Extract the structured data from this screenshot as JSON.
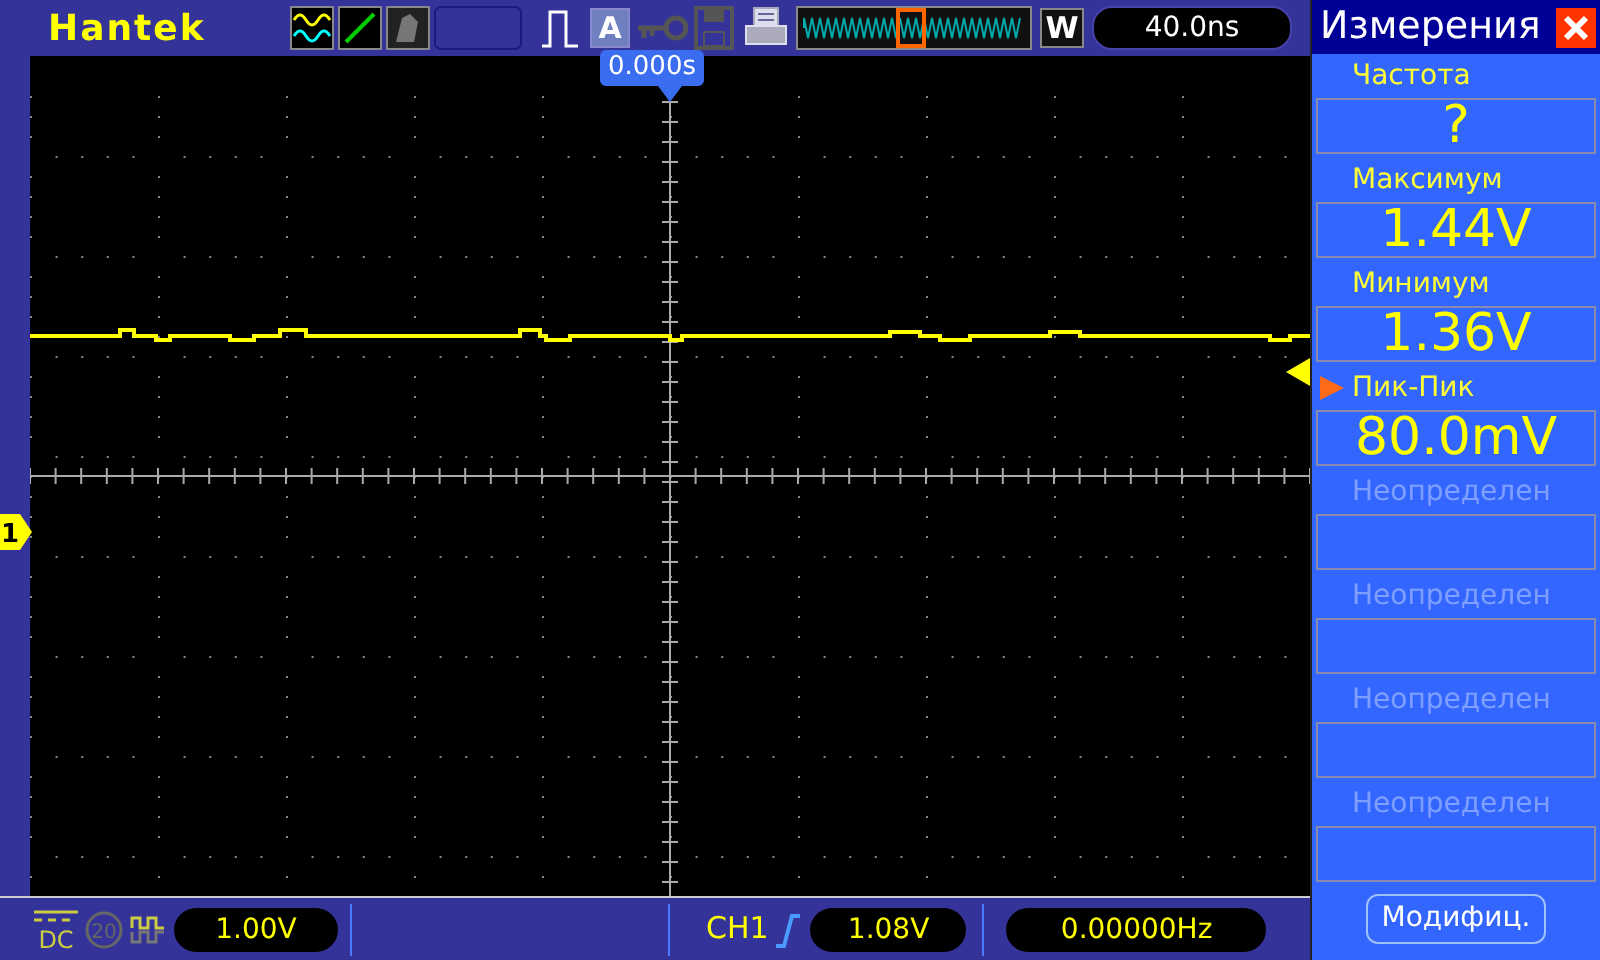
{
  "top_bar": {
    "brand": "Hantek",
    "acquire_mode": "A",
    "zoom_key": "W",
    "timebase": "40.0ns",
    "trigger_position": "0.000s"
  },
  "screen": {
    "channel_marker": "1"
  },
  "measurements": {
    "title": "Измерения",
    "items": [
      {
        "label": "Частота",
        "value": "?",
        "selected": false,
        "disabled": false
      },
      {
        "label": "Максимум",
        "value": "1.44V",
        "selected": false,
        "disabled": false
      },
      {
        "label": "Минимум",
        "value": "1.36V",
        "selected": false,
        "disabled": false
      },
      {
        "label": "Пик-Пик",
        "value": "80.0mV",
        "selected": true,
        "disabled": false
      },
      {
        "label": "Неопределен",
        "selected": false,
        "disabled": true
      },
      {
        "label": "Неопределен",
        "selected": false,
        "disabled": true
      },
      {
        "label": "Неопределен",
        "selected": false,
        "disabled": true
      },
      {
        "label": "Неопределен",
        "selected": false,
        "disabled": true
      }
    ],
    "button": "Модифиц."
  },
  "status_bar": {
    "coupling": "DC",
    "bw_limit": "20",
    "volts_per_div": "1.00V",
    "trigger_source": "CH1",
    "trigger_level": "1.08V",
    "frequency": "0.00000Hz"
  }
}
